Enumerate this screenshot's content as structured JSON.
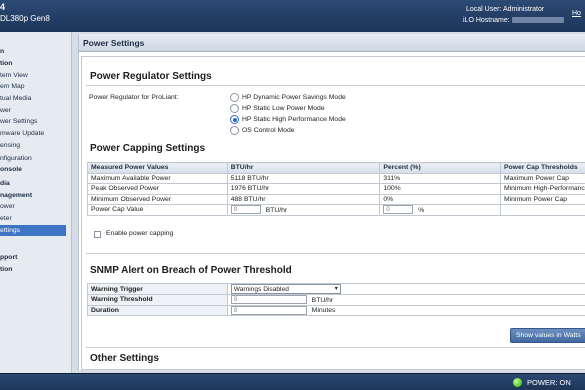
{
  "header": {
    "brand_line1": "4",
    "brand_line2": "DL380p Gen8",
    "local_user_label": "Local User:",
    "local_user_value": "Administrator",
    "ilo_hostname_label": "iLO Hostname:",
    "ilo_hostname_value": "",
    "home_link": "Ho"
  },
  "sidebar": {
    "items": [
      {
        "label": "n",
        "bold": true
      },
      {
        "label": "tion",
        "bold": true
      },
      {
        "label": "tem View",
        "bold": false
      },
      {
        "label": "em Map",
        "bold": false
      },
      {
        "label": "tual Media",
        "bold": false
      },
      {
        "label": "wer",
        "bold": false
      },
      {
        "label": "wer Settings",
        "bold": false
      },
      {
        "label": "mware Update",
        "bold": false
      },
      {
        "label": "ensing",
        "bold": false
      },
      {
        "label": "nfiguration",
        "bold": false
      },
      {
        "label": "onsole",
        "bold": true
      },
      {
        "label": "dia",
        "bold": true
      },
      {
        "label": "nagement",
        "bold": true
      },
      {
        "label": "ower",
        "bold": false
      },
      {
        "label": "eter",
        "bold": false
      },
      {
        "label": "ettings",
        "bold": false,
        "active": true
      },
      {
        "label": "pport",
        "bold": true
      },
      {
        "label": "tion",
        "bold": true
      }
    ]
  },
  "page_title": "Power Settings",
  "regulator": {
    "title": "Power Regulator Settings",
    "label": "Power Regulator for ProLiant:",
    "options": [
      {
        "label": "HP Dynamic Power Savings Mode",
        "selected": false
      },
      {
        "label": "HP Static Low Power Mode",
        "selected": false
      },
      {
        "label": "HP Static High Performance Mode",
        "selected": true
      },
      {
        "label": "OS Control Mode",
        "selected": false
      }
    ]
  },
  "capping": {
    "title": "Power Capping Settings",
    "headers": [
      "Measured Power Values",
      "BTU/hr",
      "Percent (%)",
      "Power Cap Thresholds"
    ],
    "rows": [
      [
        "Maximum Available Power",
        "5118 BTU/hr",
        "311%",
        "Maximum Power Cap"
      ],
      [
        "Peak Observed Power",
        "1976 BTU/hr",
        "100%",
        "Minimum High-Performance"
      ],
      [
        "Minimum Observed Power",
        "488 BTU/hr",
        "0%",
        "Minimum Power Cap"
      ]
    ],
    "cap_value_label": "Power Cap Value",
    "cap_value_btu": "0",
    "cap_value_btu_unit": "BTU/hr",
    "cap_value_pct": "0",
    "cap_value_pct_unit": "%",
    "enable_label": "Enable power capping"
  },
  "snmp": {
    "title": "SNMP Alert on Breach of Power Threshold",
    "warning_trigger_label": "Warning Trigger",
    "warning_trigger_value": "Warnings Disabled",
    "warning_threshold_label": "Warning Threshold",
    "warning_threshold_value": "0",
    "warning_threshold_unit": "BTU/hr",
    "duration_label": "Duration",
    "duration_value": "0",
    "duration_unit": "Minutes",
    "show_watts_button": "Show values in Watts"
  },
  "other": {
    "title": "Other Settings"
  },
  "footer": {
    "power_status": "POWER: ON"
  },
  "colors": {
    "header_bg": "#1d3558",
    "accent": "#3d74c4",
    "power_led": "#2fb30b"
  }
}
